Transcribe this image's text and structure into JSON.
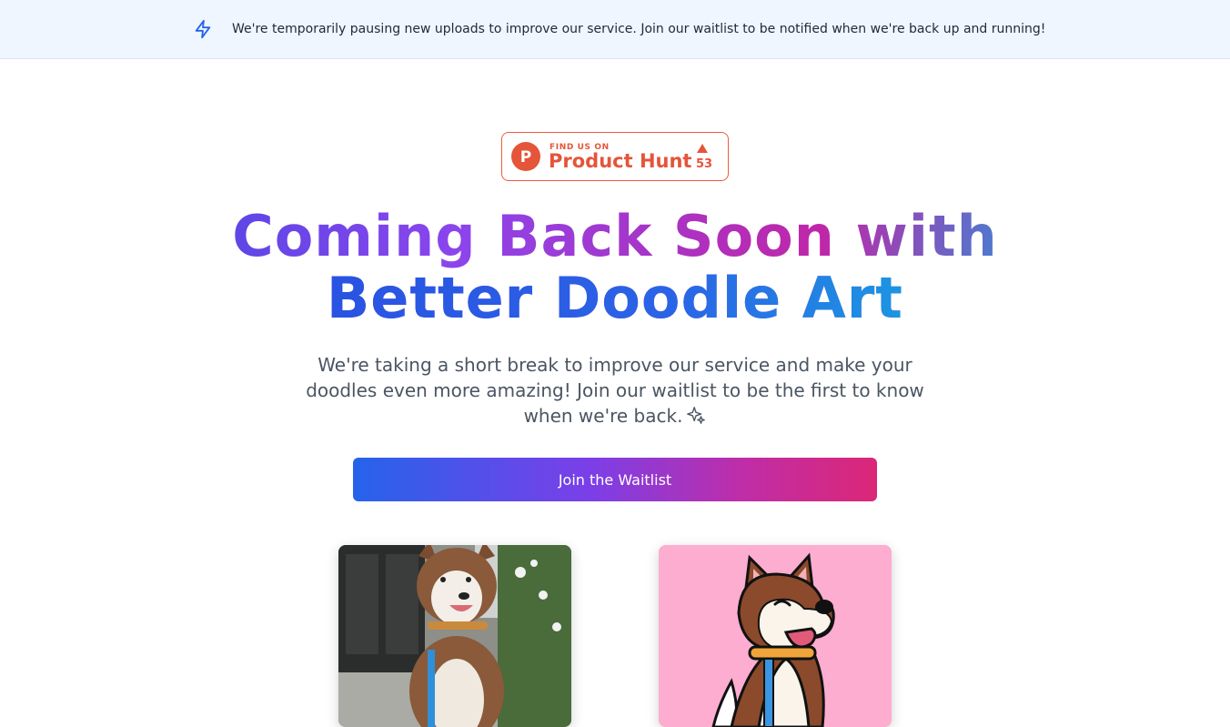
{
  "banner": {
    "icon": "lightning-bolt-icon",
    "text": "We're temporarily pausing new uploads to improve our service. Join our waitlist to be notified when we're back up and running!"
  },
  "product_hunt": {
    "small_label": "FIND US ON",
    "big_label": "Product Hunt",
    "logo_letter": "P",
    "upvote_count": "53"
  },
  "hero": {
    "headline_line1": "Coming Back Soon with",
    "headline_line2": "Better Doodle Art",
    "subtext": "We're taking a short break to improve our service and make your doodles even more amazing! Join our waitlist to be the first to know when we're back.",
    "cta_label": "Join the Waitlist"
  },
  "examples": {
    "before_image": "husky-photo",
    "after_image": "husky-doodle"
  },
  "colors": {
    "banner_bg": "#eff6ff",
    "product_hunt": "#e4553a",
    "doodle_bg": "#fcadd0",
    "cta_start": "#2563eb",
    "cta_end": "#db2777"
  }
}
